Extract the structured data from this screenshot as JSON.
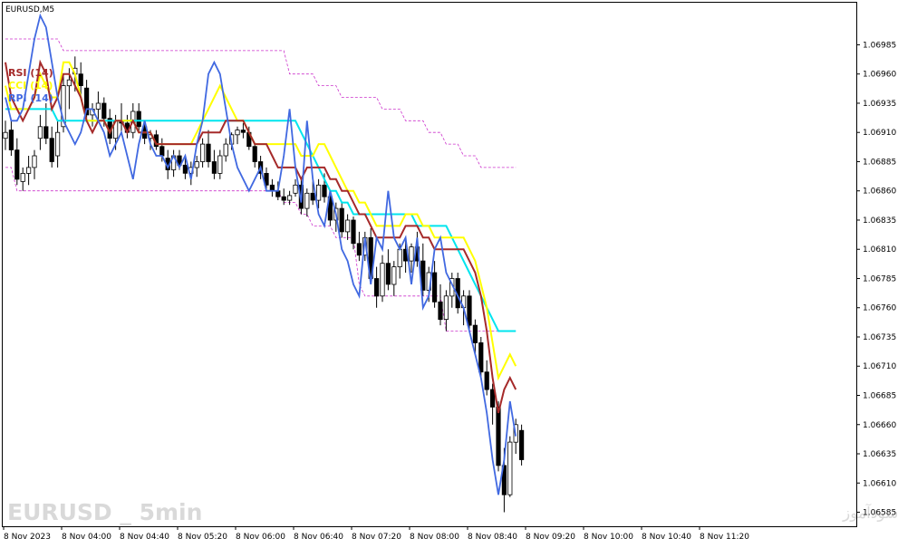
{
  "chart_data": {
    "type": "candlestick",
    "title": "EURUSD,M5",
    "watermark_left": "EURUSD _ 5min",
    "watermark_right": "انتشار در سایت سودآموز",
    "ylim": [
      1.06573,
      1.07021
    ],
    "y_ticks": [
      "1.06985",
      "1.06960",
      "1.06935",
      "1.06910",
      "1.06885",
      "1.06860",
      "1.06835",
      "1.06810",
      "1.06785",
      "1.06760",
      "1.06735",
      "1.06710",
      "1.06685",
      "1.06660",
      "1.06635",
      "1.06610",
      "1.06585"
    ],
    "x_ticks": [
      "8 Nov 2023",
      "8 Nov 04:00",
      "8 Nov 04:40",
      "8 Nov 05:20",
      "8 Nov 06:00",
      "8 Nov 06:40",
      "8 Nov 07:20",
      "8 Nov 08:00",
      "8 Nov 08:40",
      "8 Nov 09:20",
      "8 Nov 10:00",
      "8 Nov 10:40",
      "8 Nov 11:20"
    ],
    "indicators": [
      {
        "name": "RSI (14)",
        "color": "#a52a2a"
      },
      {
        "name": "CCI (14)",
        "color": "#ffff00"
      },
      {
        "name": "RPI (14)",
        "color": "#4169e1"
      }
    ],
    "envelope_color": "#00e5ee",
    "band_color": "#cc33cc",
    "candles": [
      [
        1.06905,
        1.0692,
        1.06895,
        1.0691
      ],
      [
        1.06912,
        1.0692,
        1.0689,
        1.06895
      ],
      [
        1.06895,
        1.06905,
        1.06865,
        1.0687
      ],
      [
        1.06868,
        1.0688,
        1.0686,
        1.06875
      ],
      [
        1.06875,
        1.0689,
        1.06865,
        1.0688
      ],
      [
        1.0688,
        1.06895,
        1.0687,
        1.0689
      ],
      [
        1.06905,
        1.06925,
        1.06895,
        1.06915
      ],
      [
        1.06915,
        1.06935,
        1.069,
        1.06905
      ],
      [
        1.06905,
        1.06915,
        1.0688,
        1.06885
      ],
      [
        1.0689,
        1.0692,
        1.0688,
        1.0691
      ],
      [
        1.06915,
        1.0696,
        1.0691,
        1.0695
      ],
      [
        1.0695,
        1.06965,
        1.0693,
        1.06955
      ],
      [
        1.0696,
        1.06975,
        1.06945,
        1.06965
      ],
      [
        1.0696,
        1.0697,
        1.0694,
        1.0695
      ],
      [
        1.06948,
        1.06955,
        1.0692,
        1.06925
      ],
      [
        1.06925,
        1.06935,
        1.06915,
        1.0693
      ],
      [
        1.0693,
        1.06945,
        1.0692,
        1.06935
      ],
      [
        1.06935,
        1.0694,
        1.06915,
        1.06922
      ],
      [
        1.06922,
        1.0693,
        1.069,
        1.06905
      ],
      [
        1.06905,
        1.06925,
        1.06895,
        1.0692
      ],
      [
        1.0692,
        1.06935,
        1.0691,
        1.06918
      ],
      [
        1.06918,
        1.06925,
        1.06905,
        1.0691
      ],
      [
        1.0691,
        1.06935,
        1.06905,
        1.06928
      ],
      [
        1.06928,
        1.06935,
        1.0691,
        1.06915
      ],
      [
        1.06915,
        1.0692,
        1.069,
        1.06905
      ],
      [
        1.06905,
        1.06912,
        1.06895,
        1.06908
      ],
      [
        1.06908,
        1.06912,
        1.06895,
        1.06898
      ],
      [
        1.06898,
        1.06905,
        1.06885,
        1.0689
      ],
      [
        1.06888,
        1.06895,
        1.0687,
        1.06878
      ],
      [
        1.06878,
        1.06895,
        1.06872,
        1.0689
      ],
      [
        1.0689,
        1.06895,
        1.06878,
        1.06882
      ],
      [
        1.06882,
        1.0689,
        1.0687,
        1.06875
      ],
      [
        1.06875,
        1.06885,
        1.06865,
        1.0688
      ],
      [
        1.0688,
        1.0689,
        1.06872,
        1.06885
      ],
      [
        1.06885,
        1.06905,
        1.0688,
        1.069
      ],
      [
        1.069,
        1.06912,
        1.0688,
        1.06885
      ],
      [
        1.06885,
        1.06895,
        1.0687,
        1.06875
      ],
      [
        1.06875,
        1.06895,
        1.0687,
        1.0689
      ],
      [
        1.0689,
        1.06905,
        1.06885,
        1.069
      ],
      [
        1.069,
        1.0691,
        1.06895,
        1.06908
      ],
      [
        1.06908,
        1.06915,
        1.069,
        1.06912
      ],
      [
        1.06912,
        1.06918,
        1.06905,
        1.0691
      ],
      [
        1.0691,
        1.06915,
        1.06895,
        1.06898
      ],
      [
        1.06898,
        1.069,
        1.0688,
        1.06885
      ],
      [
        1.06885,
        1.0689,
        1.0687,
        1.06875
      ],
      [
        1.06875,
        1.0688,
        1.0686,
        1.06865
      ],
      [
        1.06865,
        1.0687,
        1.06855,
        1.0686
      ],
      [
        1.0686,
        1.06868,
        1.06852,
        1.06855
      ],
      [
        1.06855,
        1.06862,
        1.06848,
        1.06852
      ],
      [
        1.06852,
        1.0686,
        1.06848,
        1.06856
      ],
      [
        1.06858,
        1.0687,
        1.06855,
        1.06865
      ],
      [
        1.06865,
        1.0687,
        1.0684,
        1.06845
      ],
      [
        1.06845,
        1.06862,
        1.06838,
        1.06858
      ],
      [
        1.06858,
        1.06868,
        1.06848,
        1.06852
      ],
      [
        1.06852,
        1.0687,
        1.06845,
        1.06865
      ],
      [
        1.06865,
        1.06875,
        1.0685,
        1.06855
      ],
      [
        1.06855,
        1.0686,
        1.0683,
        1.06835
      ],
      [
        1.06835,
        1.0685,
        1.06825,
        1.06845
      ],
      [
        1.06845,
        1.0685,
        1.0682,
        1.06825
      ],
      [
        1.06825,
        1.0684,
        1.06818,
        1.06835
      ],
      [
        1.06835,
        1.06838,
        1.0681,
        1.06815
      ],
      [
        1.06815,
        1.06825,
        1.068,
        1.06805
      ],
      [
        1.06805,
        1.06825,
        1.068,
        1.0682
      ],
      [
        1.0682,
        1.06828,
        1.0678,
        1.06785
      ],
      [
        1.06785,
        1.06795,
        1.0676,
        1.0677
      ],
      [
        1.0677,
        1.06805,
        1.06765,
        1.06798
      ],
      [
        1.06798,
        1.0681,
        1.06775,
        1.0678
      ],
      [
        1.0678,
        1.068,
        1.0677,
        1.06795
      ],
      [
        1.06795,
        1.06815,
        1.06785,
        1.0681
      ],
      [
        1.0681,
        1.0682,
        1.0679,
        1.068
      ],
      [
        1.068,
        1.06815,
        1.0679,
        1.06812
      ],
      [
        1.06812,
        1.06825,
        1.06795,
        1.068
      ],
      [
        1.068,
        1.06815,
        1.0677,
        1.06775
      ],
      [
        1.06775,
        1.06795,
        1.06765,
        1.0679
      ],
      [
        1.0679,
        1.068,
        1.0676,
        1.06765
      ],
      [
        1.06765,
        1.0678,
        1.06745,
        1.0675
      ],
      [
        1.0675,
        1.06775,
        1.0674,
        1.0677
      ],
      [
        1.0677,
        1.0679,
        1.0676,
        1.06785
      ],
      [
        1.06785,
        1.0679,
        1.06755,
        1.0676
      ],
      [
        1.0676,
        1.06775,
        1.06745,
        1.0677
      ],
      [
        1.0677,
        1.06775,
        1.0674,
        1.06745
      ],
      [
        1.06745,
        1.0675,
        1.0672,
        1.0673
      ],
      [
        1.0673,
        1.06735,
        1.067,
        1.06705
      ],
      [
        1.06705,
        1.06715,
        1.06685,
        1.0669
      ],
      [
        1.0669,
        1.06695,
        1.0666,
        1.06675
      ],
      [
        1.06675,
        1.0668,
        1.0662,
        1.06625
      ],
      [
        1.06625,
        1.0664,
        1.06585,
        1.066
      ],
      [
        1.066,
        1.0665,
        1.06598,
        1.06645
      ],
      [
        1.06645,
        1.06665,
        1.06635,
        1.0666
      ],
      [
        1.06655,
        1.0666,
        1.06625,
        1.0663
      ]
    ],
    "rsi": [
      1.0697,
      1.0694,
      1.0693,
      1.0692,
      1.0693,
      1.0694,
      1.0697,
      1.0696,
      1.0693,
      1.0694,
      1.0696,
      1.0696,
      1.0695,
      1.0694,
      1.0692,
      1.0691,
      1.0692,
      1.0692,
      1.0691,
      1.0692,
      1.0692,
      1.0691,
      1.0692,
      1.0691,
      1.0691,
      1.0691,
      1.069,
      1.069,
      1.069,
      1.069,
      1.069,
      1.069,
      1.069,
      1.069,
      1.0691,
      1.0691,
      1.0691,
      1.0691,
      1.0692,
      1.0692,
      1.0692,
      1.0692,
      1.0691,
      1.069,
      1.069,
      1.069,
      1.0689,
      1.0688,
      1.0688,
      1.0688,
      1.0688,
      1.0687,
      1.0688,
      1.0688,
      1.0688,
      1.0688,
      1.0687,
      1.0687,
      1.0686,
      1.0686,
      1.0685,
      1.0684,
      1.0684,
      1.0683,
      1.0682,
      1.0682,
      1.0682,
      1.0682,
      1.0682,
      1.0683,
      1.0683,
      1.0683,
      1.0682,
      1.0682,
      1.0681,
      1.0681,
      1.0681,
      1.0681,
      1.0681,
      1.0681,
      1.068,
      1.0679,
      1.0677,
      1.0674,
      1.067,
      1.0667,
      1.0669,
      1.067,
      1.0669
    ],
    "cci": [
      1.0695,
      1.0693,
      1.0693,
      1.0693,
      1.0693,
      1.0694,
      1.0696,
      1.0695,
      1.0694,
      1.0694,
      1.0697,
      1.0697,
      1.0696,
      1.0694,
      1.0692,
      1.0692,
      1.0692,
      1.0692,
      1.0691,
      1.0692,
      1.0692,
      1.0692,
      1.0692,
      1.0691,
      1.0691,
      1.0691,
      1.069,
      1.069,
      1.069,
      1.069,
      1.069,
      1.069,
      1.069,
      1.0691,
      1.0692,
      1.0693,
      1.0694,
      1.0695,
      1.0694,
      1.0693,
      1.0692,
      1.0692,
      1.0691,
      1.069,
      1.069,
      1.069,
      1.069,
      1.069,
      1.069,
      1.069,
      1.069,
      1.0689,
      1.0689,
      1.0689,
      1.069,
      1.069,
      1.0689,
      1.0688,
      1.0687,
      1.0686,
      1.0686,
      1.0685,
      1.0685,
      1.0684,
      1.0683,
      1.0683,
      1.0683,
      1.0683,
      1.0683,
      1.0684,
      1.0684,
      1.0684,
      1.0683,
      1.0683,
      1.0682,
      1.0682,
      1.0682,
      1.0682,
      1.0682,
      1.0682,
      1.0681,
      1.068,
      1.0678,
      1.0676,
      1.0673,
      1.067,
      1.0671,
      1.0672,
      1.0671
    ],
    "rpi": [
      1.0694,
      1.0692,
      1.0692,
      1.0693,
      1.0696,
      1.0699,
      1.0701,
      1.07,
      1.0697,
      1.0694,
      1.0692,
      1.0691,
      1.069,
      1.0691,
      1.0693,
      1.0693,
      1.0692,
      1.0691,
      1.0689,
      1.069,
      1.0691,
      1.0689,
      1.0687,
      1.069,
      1.0692,
      1.069,
      1.0689,
      1.0689,
      1.0688,
      1.0689,
      1.0688,
      1.0689,
      1.0687,
      1.069,
      1.0692,
      1.0696,
      1.0697,
      1.0696,
      1.0693,
      1.069,
      1.0688,
      1.0687,
      1.0686,
      1.0687,
      1.0688,
      1.0686,
      1.0686,
      1.0686,
      1.0689,
      1.0693,
      1.0688,
      1.0685,
      1.0692,
      1.0687,
      1.0684,
      1.0683,
      1.0686,
      1.0684,
      1.0681,
      1.068,
      1.0678,
      1.0677,
      1.0682,
      1.0678,
      1.0682,
      1.0681,
      1.0686,
      1.0682,
      1.0681,
      1.0682,
      1.0678,
      1.0682,
      1.0676,
      1.0677,
      1.0681,
      1.0682,
      1.0679,
      1.0678,
      1.0677,
      1.0676,
      1.0674,
      1.0672,
      1.067,
      1.0667,
      1.0663,
      1.066,
      1.0663,
      1.0668,
      1.0665
    ],
    "envelope_mid": [
      1.0693,
      1.0693,
      1.0693,
      1.0693,
      1.0693,
      1.0693,
      1.0693,
      1.0693,
      1.0693,
      1.0692,
      1.0692,
      1.0692,
      1.0692,
      1.0692,
      1.0692,
      1.0692,
      1.0692,
      1.0692,
      1.0692,
      1.0692,
      1.0692,
      1.0692,
      1.0692,
      1.0692,
      1.0692,
      1.0692,
      1.0692,
      1.0692,
      1.0692,
      1.0692,
      1.0692,
      1.0692,
      1.0692,
      1.0692,
      1.0692,
      1.0692,
      1.0692,
      1.0692,
      1.0692,
      1.0692,
      1.0692,
      1.0692,
      1.0692,
      1.0692,
      1.0692,
      1.0692,
      1.0692,
      1.0692,
      1.0692,
      1.0692,
      1.0692,
      1.0691,
      1.069,
      1.0689,
      1.0688,
      1.0687,
      1.0686,
      1.0686,
      1.0685,
      1.0685,
      1.0684,
      1.0684,
      1.0684,
      1.0684,
      1.0684,
      1.0684,
      1.0684,
      1.0684,
      1.0684,
      1.0684,
      1.0684,
      1.0683,
      1.0683,
      1.0683,
      1.0683,
      1.0683,
      1.0683,
      1.0682,
      1.0681,
      1.068,
      1.0679,
      1.0678,
      1.0677,
      1.0676,
      1.0675,
      1.0674,
      1.0674,
      1.0674,
      1.0674
    ],
    "band_upper": [
      1.0699,
      1.0699,
      1.0699,
      1.0699,
      1.0699,
      1.0699,
      1.0699,
      1.0699,
      1.0699,
      1.0699,
      1.0698,
      1.0698,
      1.0698,
      1.0698,
      1.0698,
      1.0698,
      1.0698,
      1.0698,
      1.0698,
      1.0698,
      1.0698,
      1.0698,
      1.0698,
      1.0698,
      1.0698,
      1.0698,
      1.0698,
      1.0698,
      1.0698,
      1.0698,
      1.0698,
      1.0698,
      1.0698,
      1.0698,
      1.0698,
      1.0698,
      1.0698,
      1.0698,
      1.0698,
      1.0698,
      1.0698,
      1.0698,
      1.0698,
      1.0698,
      1.0698,
      1.0698,
      1.0698,
      1.0698,
      1.0698,
      1.0696,
      1.0696,
      1.0696,
      1.0696,
      1.0696,
      1.0695,
      1.0695,
      1.0695,
      1.0695,
      1.0694,
      1.0694,
      1.0694,
      1.0694,
      1.0694,
      1.0694,
      1.0694,
      1.0693,
      1.0693,
      1.0693,
      1.0693,
      1.0692,
      1.0692,
      1.0692,
      1.0692,
      1.0691,
      1.0691,
      1.0691,
      1.069,
      1.069,
      1.069,
      1.0689,
      1.0689,
      1.0689,
      1.0688,
      1.0688,
      1.0688,
      1.0688,
      1.0688,
      1.0688,
      1.0688
    ],
    "band_lower": [
      1.0688,
      1.0688,
      1.0686,
      1.0686,
      1.0686,
      1.0686,
      1.0686,
      1.0686,
      1.0686,
      1.0686,
      1.0686,
      1.0686,
      1.0686,
      1.0686,
      1.0686,
      1.0686,
      1.0686,
      1.0686,
      1.0686,
      1.0686,
      1.0686,
      1.0686,
      1.0686,
      1.0686,
      1.0686,
      1.0686,
      1.0686,
      1.0686,
      1.0686,
      1.0686,
      1.0686,
      1.0686,
      1.0686,
      1.0686,
      1.0686,
      1.0686,
      1.0686,
      1.0686,
      1.0686,
      1.0686,
      1.0686,
      1.0686,
      1.0686,
      1.0686,
      1.0686,
      1.0686,
      1.0686,
      1.0686,
      1.0685,
      1.0685,
      1.0685,
      1.0684,
      1.0684,
      1.0683,
      1.0683,
      1.0683,
      1.0683,
      1.0682,
      1.0682,
      1.0682,
      1.0682,
      1.0678,
      1.0677,
      1.0677,
      1.0677,
      1.0677,
      1.0677,
      1.0677,
      1.0677,
      1.0677,
      1.0677,
      1.0677,
      1.0677,
      1.0677,
      1.0677,
      1.0677,
      1.0674,
      1.0674,
      1.0674,
      1.0674,
      1.0674,
      1.0674,
      1.0674,
      1.0674,
      1.0674,
      1.0674,
      1.0674,
      1.0674,
      1.0674
    ]
  }
}
